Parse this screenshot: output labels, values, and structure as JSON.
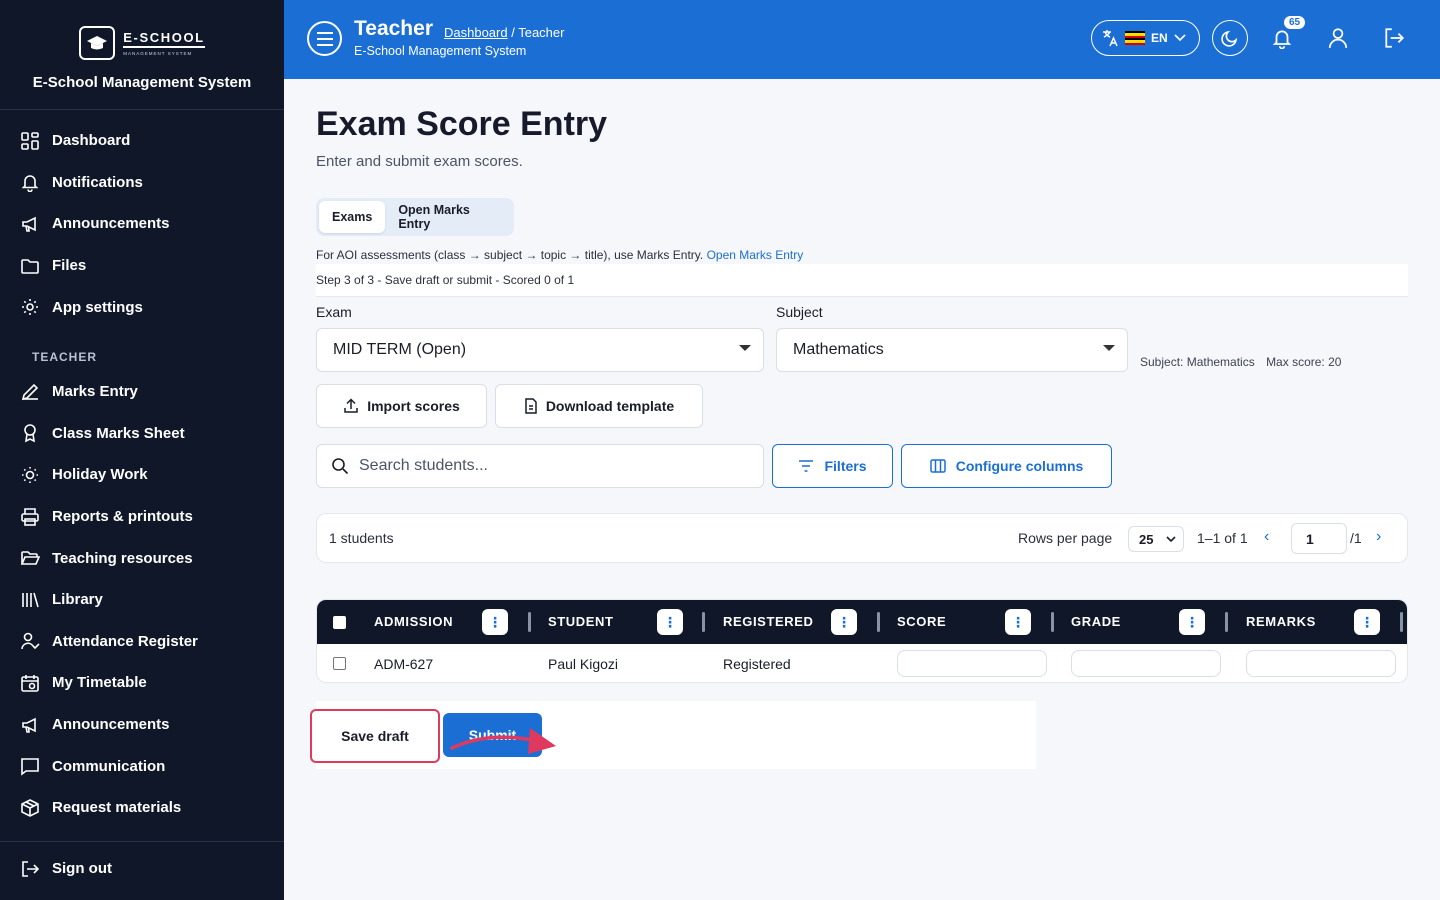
{
  "sidebar": {
    "logo_title": "E-SCHOOL",
    "logo_subtitle": "MANAGEMENT SYSTEM",
    "app_name": "E-School Management System",
    "items": [
      {
        "label": "Dashboard",
        "icon": "dashboard-icon"
      },
      {
        "label": "Notifications",
        "icon": "bell-icon"
      },
      {
        "label": "Announcements",
        "icon": "megaphone-icon"
      },
      {
        "label": "Files",
        "icon": "folder-icon"
      },
      {
        "label": "App settings",
        "icon": "gear-icon"
      }
    ],
    "section_label": "TEACHER",
    "teacher_items": [
      {
        "label": "Marks Entry",
        "icon": "pencil-icon"
      },
      {
        "label": "Class Marks Sheet",
        "icon": "award-icon"
      },
      {
        "label": "Holiday Work",
        "icon": "sun-icon"
      },
      {
        "label": "Reports & printouts",
        "icon": "printer-icon"
      },
      {
        "label": "Teaching resources",
        "icon": "folder-open-icon"
      },
      {
        "label": "Library",
        "icon": "library-icon"
      },
      {
        "label": "Attendance Register",
        "icon": "user-check-icon"
      },
      {
        "label": "My Timetable",
        "icon": "calendar-icon"
      },
      {
        "label": "Announcements",
        "icon": "megaphone-icon"
      },
      {
        "label": "Communication",
        "icon": "chat-icon"
      },
      {
        "label": "Request materials",
        "icon": "package-icon"
      }
    ],
    "sign_out": "Sign out"
  },
  "header": {
    "title": "Teacher",
    "breadcrumb_link": "Dashboard",
    "breadcrumb_current": " / Teacher",
    "subtitle": "E-School Management System",
    "language": "EN",
    "notification_count": "65",
    "colors": {
      "bar": "#1b6fd4"
    }
  },
  "page": {
    "title": "Exam Score Entry",
    "subtitle": "Enter and submit exam scores.",
    "tabs": [
      "Exams",
      "Open Marks Entry"
    ],
    "aoi_text": "For AOI assessments (class → subject → topic → title), use Marks Entry.",
    "aoi_link": "Open Marks Entry",
    "step_text": "Step 3 of 3 - Save draft or submit - Scored 0 of 1",
    "exam_label": "Exam",
    "exam_value": "MID TERM (Open)",
    "subject_label": "Subject",
    "subject_value": "Mathematics",
    "subject_info": "Subject: Mathematics",
    "max_score": "Max score: 20",
    "import_btn": "Import scores",
    "download_btn": "Download template",
    "search_placeholder": "Search students...",
    "filters_btn": "Filters",
    "configure_btn": "Configure columns"
  },
  "pager": {
    "count": "1 students",
    "rows_label": "Rows per page",
    "rows_value": "25",
    "range": "1–1 of 1",
    "page": "1",
    "of": "/1"
  },
  "table": {
    "columns": [
      "ADMISSION",
      "STUDENT",
      "REGISTERED",
      "SCORE",
      "GRADE",
      "REMARKS"
    ],
    "rows": [
      {
        "admission": "ADM-627",
        "student": "Paul Kigozi",
        "registered": "Registered"
      }
    ]
  },
  "actions": {
    "save_draft": "Save draft",
    "submit": "Submit",
    "annotation_color": "#e0395f"
  }
}
